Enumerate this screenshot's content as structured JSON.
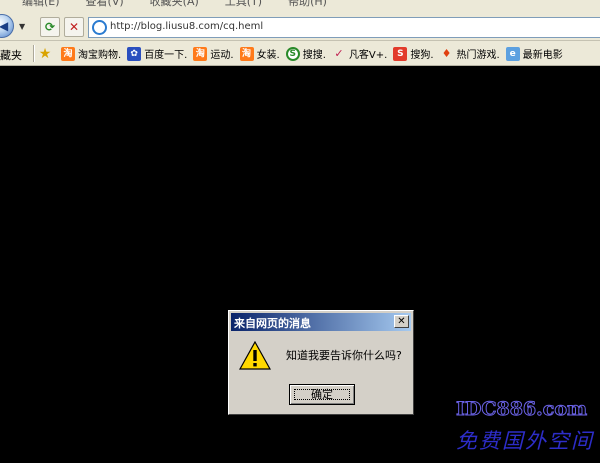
{
  "menubar": {
    "items": [
      "编辑(E)",
      "查看(V)",
      "收藏夹(A)",
      "工具(T)",
      "帮助(H)"
    ]
  },
  "toolbar": {
    "back_icon": "back-arrow-icon",
    "refresh_icon": "refresh-icon",
    "stop_icon": "stop-icon",
    "refresh_glyph": "⟳",
    "stop_glyph": "✕",
    "address_url": "http://blog.liusu8.com/cq.heml"
  },
  "favbar": {
    "label": "藏夹",
    "items": [
      {
        "label": "淘宝购物.",
        "icon": "taobao-icon"
      },
      {
        "label": "百度一下.",
        "icon": "baidu-paw-icon"
      },
      {
        "label": "运动.",
        "icon": "taobao-icon"
      },
      {
        "label": "女装.",
        "icon": "taobao-icon"
      },
      {
        "label": "搜搜.",
        "icon": "soso-icon"
      },
      {
        "label": "凡客V+.",
        "icon": "vancl-icon"
      },
      {
        "label": "搜狗.",
        "icon": "sogou-icon"
      },
      {
        "label": "热门游戏.",
        "icon": "game-icon"
      },
      {
        "label": "最新电影",
        "icon": "ie-page-icon"
      }
    ]
  },
  "dialog": {
    "title": "来自网页的消息",
    "close_glyph": "✕",
    "message": "知道我要告诉你什么吗?",
    "ok_label": "确定",
    "icon": "warning-icon"
  },
  "watermark": {
    "line1": "IDC886.com",
    "line2": "免费国外空间"
  },
  "colors": {
    "page_background": "#000000",
    "chrome": "#ece9d8",
    "dialog_title_start": "#0a246a",
    "dialog_title_end": "#a6caf0",
    "watermark": "#2d2dc8"
  }
}
